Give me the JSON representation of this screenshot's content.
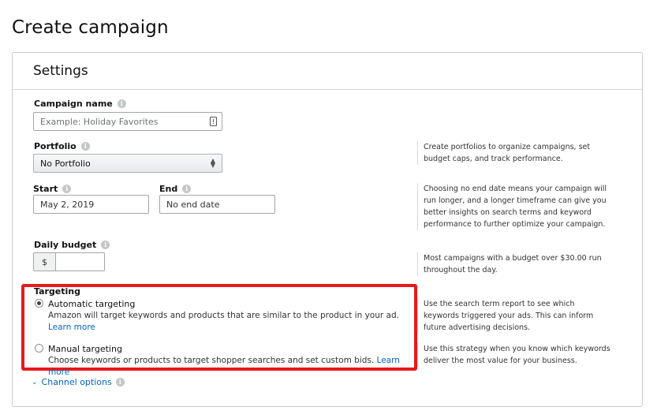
{
  "page": {
    "title": "Create campaign"
  },
  "settings": {
    "title": "Settings"
  },
  "campaign_name": {
    "label": "Campaign name",
    "placeholder": "Example: Holiday Favorites"
  },
  "portfolio": {
    "label": "Portfolio",
    "value": "No Portfolio",
    "help": "Create portfolios to organize campaigns, set budget caps, and track performance."
  },
  "dates": {
    "start_label": "Start",
    "start_value": "May 2, 2019",
    "end_label": "End",
    "end_value": "No end date",
    "help": "Choosing no end date means your campaign will run longer, and a longer timeframe can give you better insights on search terms and keyword performance to further optimize your campaign."
  },
  "budget": {
    "label": "Daily budget",
    "currency": "$",
    "value": "",
    "help": "Most campaigns with a budget over $30.00 run throughout the day."
  },
  "targeting": {
    "label": "Targeting",
    "automatic": {
      "title": "Automatic targeting",
      "desc": "Amazon will target keywords and products that are similar to the product in your ad.",
      "link": "Learn more",
      "selected": true,
      "help": "Use the search term report to see which keywords triggered your ads. This can inform future advertising decisions."
    },
    "manual": {
      "title": "Manual targeting",
      "desc": "Choose keywords or products to target shopper searches and set custom bids.",
      "link": "Learn more",
      "selected": false,
      "help": "Use this strategy when you know which keywords deliver the most value for your business."
    },
    "highlight_color": "#e8191c"
  },
  "channel_options": {
    "label": "Channel options"
  },
  "icons": {
    "info": "info-icon",
    "chevron": "chevron-down-icon",
    "clip": "clipboard-icon"
  }
}
